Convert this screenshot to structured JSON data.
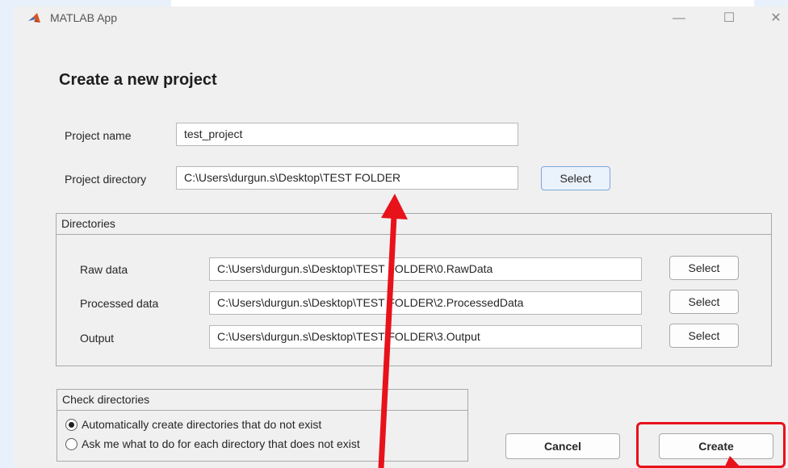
{
  "window": {
    "title": "MATLAB App",
    "minimize_glyph": "—",
    "maximize_glyph": "☐",
    "close_glyph": "✕",
    "icon": "matlab-logo-icon"
  },
  "page": {
    "heading": "Create a new project"
  },
  "project": {
    "name_label": "Project name",
    "name_value": "test_project",
    "dir_label": "Project directory",
    "dir_value": "C:\\Users\\durgun.s\\Desktop\\TEST FOLDER",
    "select_label": "Select"
  },
  "directories": {
    "title": "Directories",
    "rows": [
      {
        "label": "Raw data",
        "value": "C:\\Users\\durgun.s\\Desktop\\TEST FOLDER\\0.RawData",
        "button": "Select"
      },
      {
        "label": "Processed data",
        "value": "C:\\Users\\durgun.s\\Desktop\\TEST FOLDER\\2.ProcessedData",
        "button": "Select"
      },
      {
        "label": "Output",
        "value": "C:\\Users\\durgun.s\\Desktop\\TEST FOLDER\\3.Output",
        "button": "Select"
      }
    ]
  },
  "check": {
    "title": "Check directories",
    "options": [
      {
        "label": "Automatically create directories that do not exist",
        "selected": true
      },
      {
        "label": "Ask me what to do for each directory that does not exist",
        "selected": false
      }
    ]
  },
  "actions": {
    "cancel_label": "Cancel",
    "create_label": "Create"
  },
  "colors": {
    "annotation_red": "#e8121b",
    "select_button_border": "#7fa6d8",
    "matlab_orange": "#d9541e"
  }
}
